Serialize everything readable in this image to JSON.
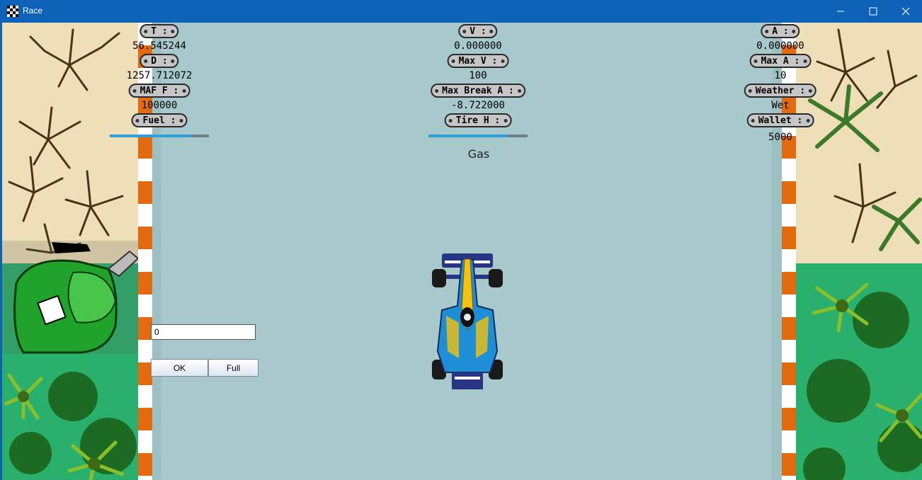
{
  "window": {
    "title": "Race",
    "minimize_glyph": "—",
    "maximize_glyph": "☐",
    "close_glyph": "✕"
  },
  "hud_left": [
    {
      "label": "T :",
      "value": "56.545244"
    },
    {
      "label": "D :",
      "value": "1257.712072"
    },
    {
      "label": "MAF F :",
      "value": "100000"
    },
    {
      "label": "Fuel :",
      "value": ""
    }
  ],
  "hud_center": [
    {
      "label": "V :",
      "value": "0.000000"
    },
    {
      "label": "Max V :",
      "value": "100"
    },
    {
      "label": "Max Break A :",
      "value": "-8.722000"
    },
    {
      "label": "Tire H :",
      "value": ""
    }
  ],
  "hud_right": [
    {
      "label": "A :",
      "value": "0.000000"
    },
    {
      "label": "Max A :",
      "value": "10"
    },
    {
      "label": "Weather :",
      "value": "Wet"
    },
    {
      "label": "Wallet :",
      "value": "5000"
    }
  ],
  "fuel_level": 0.82,
  "tire_health": 0.8,
  "mode_text": "Gas",
  "input": {
    "value": "0"
  },
  "buttons": {
    "ok": "OK",
    "full": "Full"
  },
  "colors": {
    "titlebar": "#0d62b8",
    "road": "#a7c9cc",
    "curb_orange": "#e46a12",
    "sand": "#efdfb8",
    "grass": "#29b06c",
    "gauge_fill": "#2f9fd6"
  },
  "icons": [
    "race-app-icon",
    "minimize-icon",
    "maximize-icon",
    "close-icon",
    "gas-station-icon",
    "race-car",
    "dead-tree",
    "palm-tree",
    "jungle-plant"
  ]
}
